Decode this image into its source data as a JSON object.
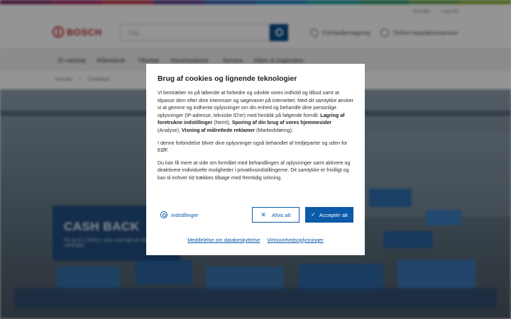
{
  "colors": {
    "brand_red": "#c0252b",
    "accent_blue": "#0b5aa8",
    "rainbow": [
      "#7a2d6d",
      "#a42d62",
      "#c23a4c",
      "#5a3f8f",
      "#2f5fa8",
      "#1d7fb8",
      "#1f9aa6",
      "#2e9c6e",
      "#6aa84f",
      "#8fb13f"
    ]
  },
  "utility": {
    "left_link": "Kontakt",
    "right_link": "Log ind"
  },
  "header": {
    "brand": "BOSCH",
    "search_placeholder": "Søg",
    "dealer_link": "Forhandlersøgning",
    "service_link": "Online-reparationsservice"
  },
  "nav": {
    "items": [
      "El-værktøj",
      "Måleteknik",
      "Tilbehør",
      "Havemaskiner",
      "Service",
      "Viden & Inspiration"
    ]
  },
  "breadcrumb": [
    "Forside",
    "Cashback"
  ],
  "promo": {
    "title": "CASH BACK",
    "subtitle": "Få op til 1.000 kr. retur ved køb af udvalgte Bosch værktøjer"
  },
  "cookie_dialog": {
    "title": "Brug af cookies og lignende teknologier",
    "p1_intro": "Vi bestræber os på løbende at forbedre og udvikle vores indhold og tilbud samt at tilpasse dem efter dine interesser og søgevaner på internettet. Med dit samtykke ønsker vi at gemme og indhente oplysninger om din enhed og behandle dine personlige oplysninger (IP-adresse, tekniske ID'er) med henblik på følgende formål: ",
    "purpose_1": "Lagring af foretrukne indstillinger",
    "purpose_1_tag": " (Nemt), ",
    "purpose_2": "Sporing af din brug af vores hjemmesider",
    "purpose_2_tag": " (Analyse), ",
    "purpose_3": "Visning af målrettede reklamer",
    "purpose_3_tag": " (Markedsføring).",
    "p2": "I denne forbindelse bliver dine oplysninger også behandlet af tredjeparter og uden for EØF.",
    "p3": "Du kan få mere at vide om formålet med behandlingen af oplysninger samt aktivere og deaktivere individuelle muligheder i privatlivsindstillingerne. Dit samtykke er frivilligt og kan til enhver tid trækkes tilbage med fremtidig virkning.",
    "settings_label": "Indstillinger",
    "reject_label": "Afvis alt",
    "accept_label": "Acceptér alt",
    "privacy_link": "Meddelelse om databeskyttelse",
    "company_link": "Virksomhedsoplysninger"
  }
}
